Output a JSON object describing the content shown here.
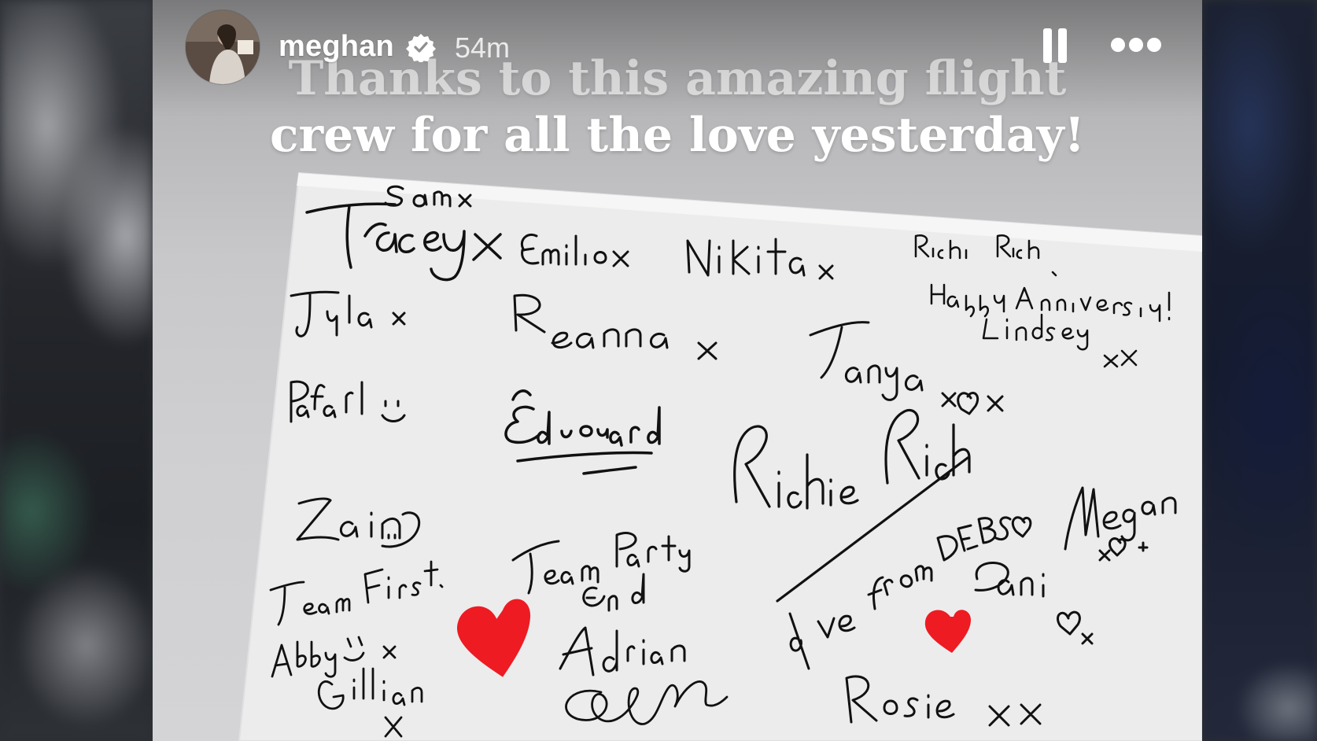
{
  "story": {
    "username": "meghan",
    "timestamp": "54m",
    "caption_line1": "Thanks to this amazing flight",
    "caption_line2": "crew for all the love yesterday!"
  },
  "card_signatures": [
    "Sam x",
    "Tracey x",
    "Emilio x",
    "Nikita x",
    "Richie Rich x",
    "Happy Anniversary!",
    "Lindsey xx",
    "Tyla x",
    "Reanna x",
    "Tanya x",
    "Rafael",
    "Edouard",
    "Richie Rich",
    "Zain",
    "Team Party End",
    "Love from DEBS",
    "Megan x",
    "Team First.",
    "Abby x",
    "Gillian",
    "Adrian",
    "Rosie xx",
    "Dani"
  ],
  "icons": {
    "verified": "verified-badge-icon",
    "pause": "pause-icon",
    "more": "more-options-icon",
    "hearts": "red-heart-sticker"
  },
  "colors": {
    "heart": "#ee1b22",
    "ink": "#111111",
    "card": "#f2f2f2"
  }
}
